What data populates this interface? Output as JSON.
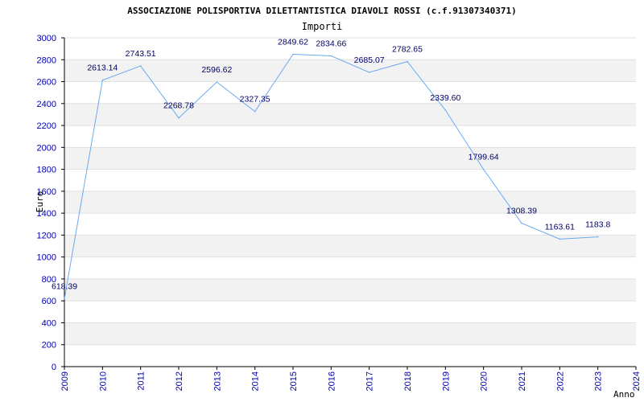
{
  "chart_data": {
    "type": "line",
    "title": "ASSOCIAZIONE POLISPORTIVA DILETTANTISTICA DIAVOLI ROSSI (c.f.91307340371)",
    "subtitle": "Importi",
    "xlabel": "Anno",
    "ylabel": "Euro",
    "ylim": [
      0,
      3000
    ],
    "yticks": [
      0,
      200,
      400,
      600,
      800,
      1000,
      1200,
      1400,
      1600,
      1800,
      2000,
      2200,
      2400,
      2600,
      2800,
      3000
    ],
    "categories": [
      "2009",
      "2010",
      "2011",
      "2012",
      "2013",
      "2014",
      "2015",
      "2016",
      "2017",
      "2018",
      "2019",
      "2020",
      "2021",
      "2022",
      "2023",
      "2024"
    ],
    "values": [
      618.39,
      2613.14,
      2743.51,
      2268.78,
      2596.62,
      2327.35,
      2849.62,
      2834.66,
      2685.07,
      2782.65,
      2339.6,
      1799.64,
      1308.39,
      1163.61,
      1183.85
    ],
    "value_labels": [
      "618.39",
      "2613.14",
      "2743.51",
      "2268.78",
      "2596.62",
      "2327.35",
      "2849.62",
      "2834.66",
      "2685.07",
      "2782.65",
      "2339.60",
      "1799.64",
      "1308.39",
      "1163.61",
      "1183.8"
    ],
    "grid": true,
    "colors": {
      "line": "#6aaaf0",
      "band": "#f2f2f2",
      "grid": "#e0e0e0",
      "axis": "#000000",
      "tick_text": "#0000aa",
      "data_text": "#000066"
    }
  }
}
